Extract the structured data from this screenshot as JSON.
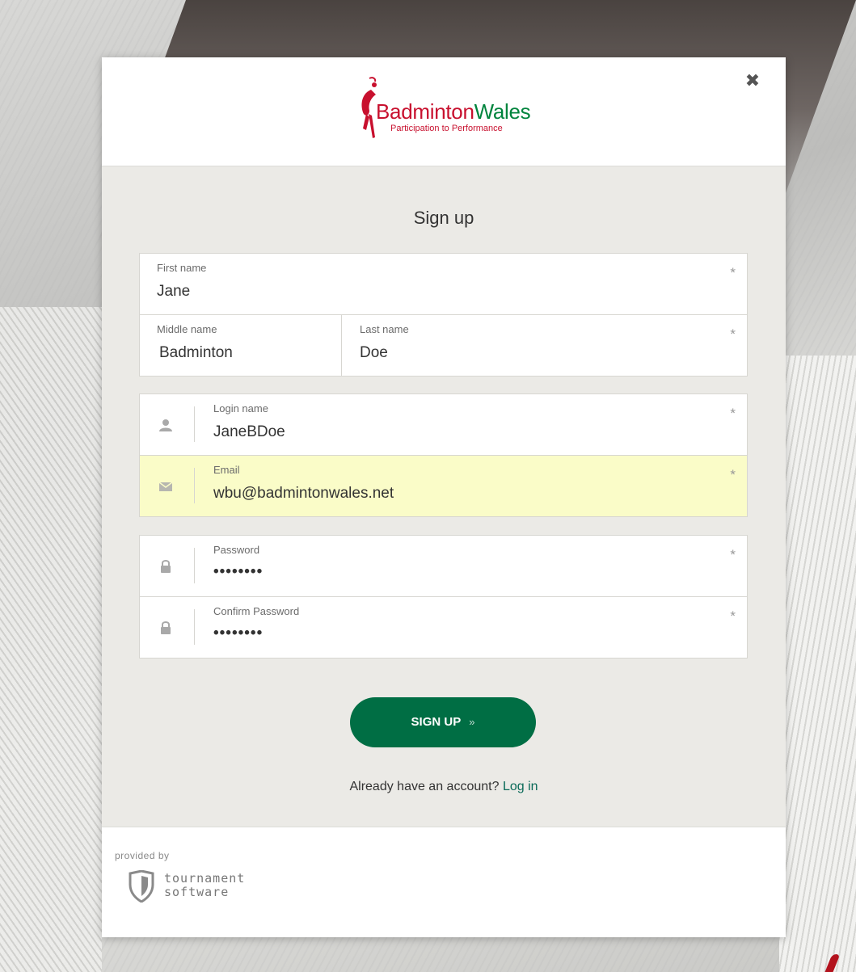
{
  "brand": {
    "name_part1": "Badminton",
    "name_part2": "Wales",
    "tagline": "Participation to Performance",
    "red": "#c8102e",
    "green": "#00843d"
  },
  "modal": {
    "close_icon": "close-icon",
    "title": "Sign up"
  },
  "form": {
    "first_name": {
      "label": "First name",
      "value": "Jane",
      "required": "*"
    },
    "middle_name": {
      "label": "Middle name",
      "value": "Badminton"
    },
    "last_name": {
      "label": "Last name",
      "value": "Doe",
      "required": "*"
    },
    "login_name": {
      "label": "Login name",
      "value": "JaneBDoe",
      "required": "*",
      "icon": "user-icon"
    },
    "email": {
      "label": "Email",
      "value": "wbu@badmintonwales.net",
      "required": "*",
      "icon": "envelope-icon"
    },
    "password": {
      "label": "Password",
      "value": "••••••••",
      "required": "*",
      "icon": "lock-icon"
    },
    "confirm_password": {
      "label": "Confirm Password",
      "value": "••••••••",
      "required": "*",
      "icon": "lock-icon"
    }
  },
  "actions": {
    "signup_label": "SIGN UP",
    "signup_chevron": "»",
    "accent": "#006e44"
  },
  "login_prompt": {
    "text": "Already have an account?",
    "link": "Log in"
  },
  "footer": {
    "provided_by": "provided by",
    "brand_line1": "tournament",
    "brand_line2": "software"
  }
}
